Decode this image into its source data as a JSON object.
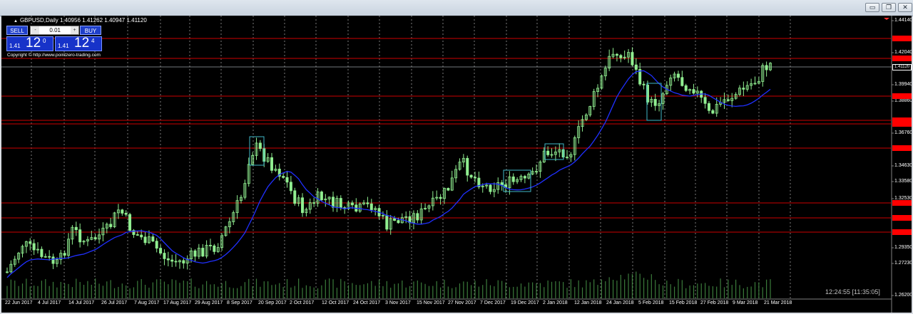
{
  "window": {
    "minimize_glyph": "▭",
    "restore_glyph": "❐",
    "close_glyph": "✕"
  },
  "chart": {
    "symbol_title": "GBPUSD,Daily",
    "ohlc": [
      "1.40956",
      "1.41262",
      "1.40947",
      "1.41120"
    ],
    "clock": "12:24:55 [11:35:05]",
    "y_labels": [
      "1.44140",
      "1.42040",
      "1.39940",
      "1.38860",
      "1.36760",
      "1.34630",
      "1.33580",
      "1.32530",
      "1.29350",
      "1.27230",
      "1.26200"
    ],
    "current_price_label": "1.41120",
    "x_labels": [
      "22 Jun 2017",
      "4 Jul 2017",
      "14 Jul 2017",
      "26 Jul 2017",
      "7 Aug 2017",
      "17 Aug 2017",
      "29 Aug 2017",
      "8 Sep 2017",
      "20 Sep 2017",
      "2 Oct 2017",
      "12 Oct 2017",
      "24 Oct 2017",
      "3 Nov 2017",
      "15 Nov 2017",
      "27 Nov 2017",
      "7 Dec 2017",
      "19 Dec 2017",
      "2 Jan 2018",
      "12 Jan 2018",
      "24 Jan 2018",
      "5 Feb 2018",
      "15 Feb 2018",
      "27 Feb 2018",
      "9 Mar 2018",
      "21 Mar 2018"
    ],
    "colors": {
      "background": "#000000",
      "candle": "#90ee90",
      "moving_average": "#2030ff",
      "level_line": "#cc0000",
      "grid": "#ffffff",
      "volume": "#4a9a4a"
    },
    "candle_count": 200
  },
  "trade_panel": {
    "sell_label": "SELL",
    "buy_label": "BUY",
    "lot_value": "0.01",
    "minus_glyph": "-",
    "plus_glyph": "+",
    "sell_quote": {
      "prefix": "1.41",
      "big": "12",
      "sup": "0"
    },
    "buy_quote": {
      "prefix": "1.41",
      "big": "12",
      "sup": "4"
    },
    "copyright": "Copyright © http://www.pointzero-trading.com"
  }
}
